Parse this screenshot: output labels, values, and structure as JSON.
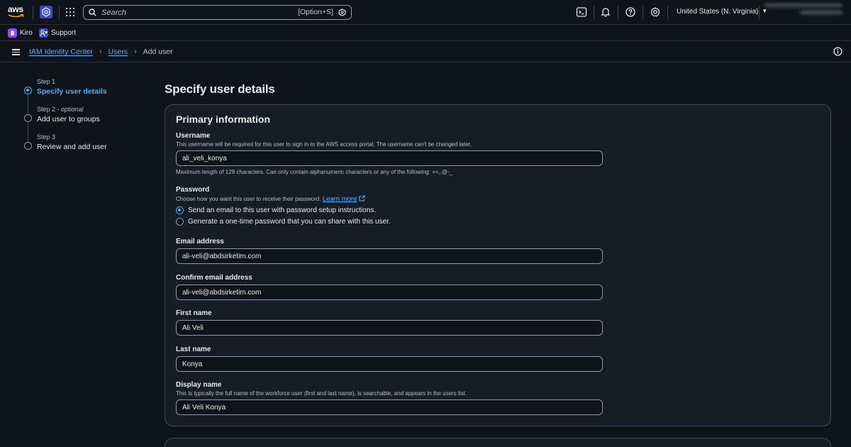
{
  "topnav": {
    "logo_text": "aws",
    "search_placeholder": "Search",
    "search_shortcut": "[Option+S]",
    "region": "United States (N. Virginia)"
  },
  "favorites": [
    {
      "label": "Kiro"
    },
    {
      "label": "Support"
    }
  ],
  "breadcrumbs": {
    "root": "IAM Identity Center",
    "parent": "Users",
    "current": "Add user"
  },
  "steps": [
    {
      "label": "Step 1",
      "optional": "",
      "title": "Specify user details",
      "active": true
    },
    {
      "label": "Step 2 - ",
      "optional": "optional",
      "title": "Add user to groups",
      "active": false
    },
    {
      "label": "Step 3",
      "optional": "",
      "title": "Review and add user",
      "active": false
    }
  ],
  "page_title": "Specify user details",
  "primary": {
    "heading": "Primary information",
    "username": {
      "label": "Username",
      "description": "This username will be required for this user to sign in to the AWS access portal. The username can't be changed later.",
      "value": "ali_veli_konya",
      "hint": "Maximum length of 128 characters. Can only contain alphanumeric characters or any of the following: +=,.@-_"
    },
    "password": {
      "label": "Password",
      "description": "Choose how you want this user to receive their password.",
      "learn_more": "Learn more",
      "options": [
        "Send an email to this user with password setup instructions.",
        "Generate a one-time password that you can share with this user."
      ],
      "selected": 0
    },
    "email": {
      "label": "Email address",
      "value": "ali-veli@abdsirketim.com"
    },
    "confirm_email": {
      "label": "Confirm email address",
      "value": "ali-veli@abdsirketim.com"
    },
    "first_name": {
      "label": "First name",
      "value": "Ali Veli"
    },
    "last_name": {
      "label": "Last name",
      "value": "Konya"
    },
    "display_name": {
      "label": "Display name",
      "description": "This is typically the full name of the workforce user (first and last name), is searchable, and appears in the users list.",
      "value": "Ali Veli Konya"
    }
  },
  "colors": {
    "background": "#0f141a",
    "container": "#161d26",
    "accent": "#42b4ff",
    "border": "#414d5c"
  }
}
